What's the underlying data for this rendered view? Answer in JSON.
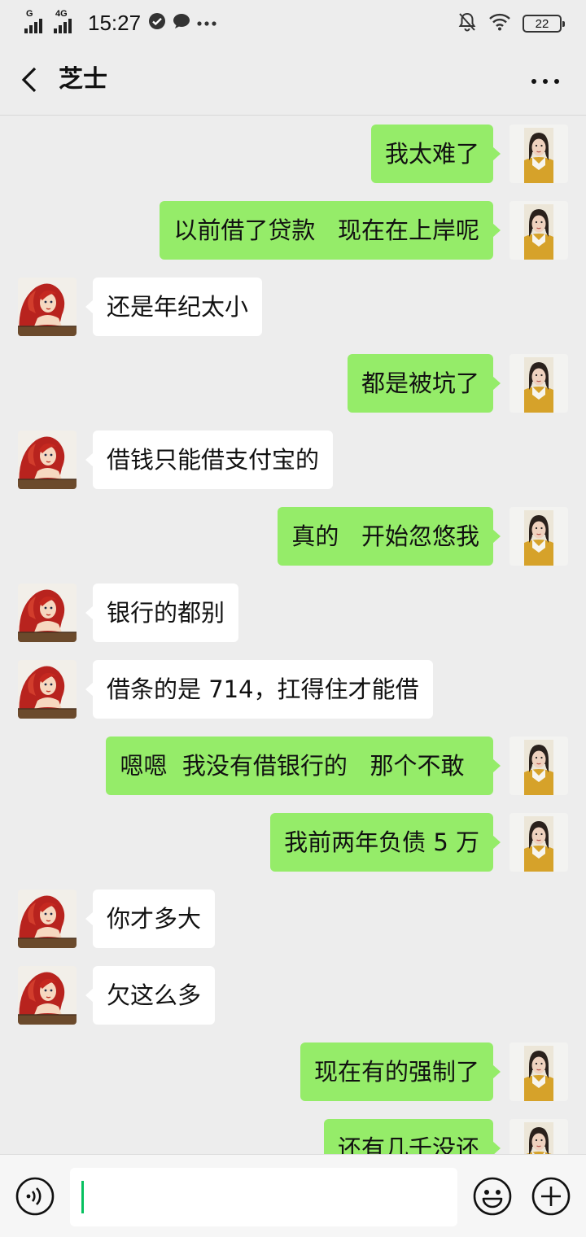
{
  "status_bar": {
    "signal1_label": "G",
    "signal2_label": "4G",
    "time": "15:27",
    "battery_level": "22",
    "icons": [
      "check-circle-icon",
      "chat-bubble-icon",
      "more-dots-icon",
      "mute-bell-icon",
      "wifi-icon",
      "battery-icon"
    ]
  },
  "header": {
    "title": "芝士",
    "back_icon": "chevron-left-icon",
    "more_icon": "more-horizontal-icon"
  },
  "messages": [
    {
      "side": "right",
      "text": "我太难了"
    },
    {
      "side": "right",
      "text": "以前借了贷款   现在在上岸呢"
    },
    {
      "side": "left",
      "text": "还是年纪太小"
    },
    {
      "side": "right",
      "text": "都是被坑了"
    },
    {
      "side": "left",
      "text": "借钱只能借支付宝的"
    },
    {
      "side": "right",
      "text": "真的   开始忽悠我"
    },
    {
      "side": "left",
      "text": "银行的都别"
    },
    {
      "side": "left",
      "text": "借条的是 714，扛得住才能借"
    },
    {
      "side": "right",
      "text": "嗯嗯  我没有借银行的   那个不敢  "
    },
    {
      "side": "right",
      "text": "我前两年负债 5 万"
    },
    {
      "side": "left",
      "text": "你才多大"
    },
    {
      "side": "left",
      "text": "欠这么多"
    },
    {
      "side": "right",
      "text": "现在有的强制了"
    },
    {
      "side": "right",
      "text": "还有几千没还"
    }
  ],
  "input_bar": {
    "value": "",
    "icons": [
      "voice-icon",
      "emoji-icon",
      "plus-icon"
    ]
  },
  "colors": {
    "background": "#ededed",
    "sent_bubble": "#95ec69",
    "received_bubble": "#ffffff",
    "cursor": "#07c160"
  }
}
